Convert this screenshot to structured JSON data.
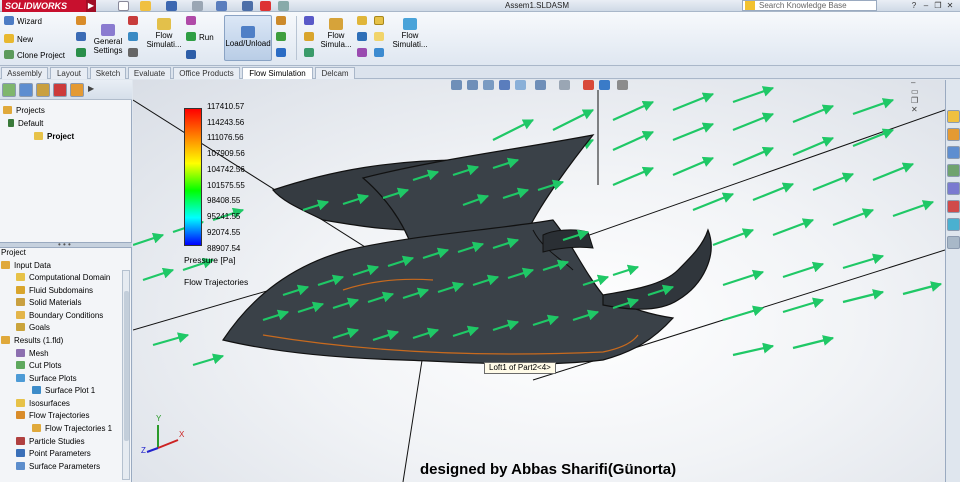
{
  "app": {
    "brand": "SOLIDWORKS",
    "document_title": "Assem1.SLDASM"
  },
  "search": {
    "placeholder": "Search Knowledge Base"
  },
  "command_manager": {
    "wizard": "Wizard",
    "new": "New",
    "clone_project": "Clone Project",
    "general_settings_line1": "General",
    "general_settings_line2": "Settings",
    "flow_simulation_line1": "Flow",
    "flow_simulation_line2": "Simulati...",
    "run": "Run",
    "load_unload": "Load/Unload",
    "flow_simulation2_line1": "Flow",
    "flow_simulation2_line2": "Simula...",
    "flow_simulation3_line1": "Flow",
    "flow_simulation3_line2": "Simulati..."
  },
  "tabs": [
    {
      "label": "Assembly"
    },
    {
      "label": "Layout"
    },
    {
      "label": "Sketch"
    },
    {
      "label": "Evaluate"
    },
    {
      "label": "Office Products"
    },
    {
      "label": "Flow Simulation",
      "active": true
    },
    {
      "label": "Delcam"
    }
  ],
  "feature_tree": {
    "projects": "Projects",
    "default": "Default",
    "project": "Project"
  },
  "analysis_tree": {
    "title": "Project",
    "items": [
      {
        "label": "Input Data"
      },
      {
        "label": "Computational Domain"
      },
      {
        "label": "Fluid Subdomains"
      },
      {
        "label": "Solid Materials"
      },
      {
        "label": "Boundary Conditions"
      },
      {
        "label": "Goals"
      },
      {
        "label": "Results (1.fld)"
      },
      {
        "label": "Mesh"
      },
      {
        "label": "Cut Plots"
      },
      {
        "label": "Surface Plots"
      },
      {
        "label": "Surface Plot 1"
      },
      {
        "label": "Isosurfaces"
      },
      {
        "label": "Flow Trajectories"
      },
      {
        "label": "Flow Trajectories 1"
      },
      {
        "label": "Particle Studies"
      },
      {
        "label": "Point Parameters"
      },
      {
        "label": "Surface Parameters"
      }
    ]
  },
  "legend": {
    "values": [
      "117410.57",
      "114243.56",
      "111076.56",
      "107909.56",
      "104742.56",
      "101575.55",
      "98408.55",
      "95241.55",
      "92074.55",
      "88907.54"
    ],
    "unit": "Pressure [Pa]",
    "trajectories": "Flow Trajectories",
    "colors": [
      "#ff0000",
      "#ff8000",
      "#ffff00",
      "#00ff00",
      "#00ffff",
      "#0000ff"
    ]
  },
  "tooltip": "Loft1 of Part2<4>",
  "credit": "designed  by Abbas Sharifi(Günorta)",
  "triad": {
    "x": "X",
    "y": "Y",
    "z": "Z"
  },
  "colors": {
    "arrow": "#1fc866",
    "body": "#3a4148",
    "brand_red": "#c8102e"
  }
}
